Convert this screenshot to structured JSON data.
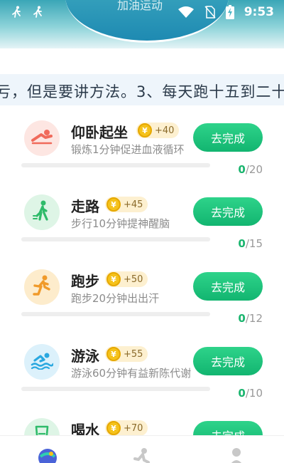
{
  "header": {
    "title": "加油运动"
  },
  "status_bar": {
    "time": "9:53"
  },
  "tip": {
    "text": "亏，但是要讲方法。3、每天跑十五到二十"
  },
  "tasks": [
    {
      "name": "仰卧起坐",
      "coin_symbol": "¥",
      "points": "+40",
      "desc": "锻炼1分钟促进血液循环",
      "button": "去完成",
      "done": "0",
      "total": "/20",
      "progress": 0,
      "icon": "situp-icon",
      "color": "#f06a5b",
      "bg": "#fde6e2"
    },
    {
      "name": "走路",
      "coin_symbol": "¥",
      "points": "+45",
      "desc": "步行10分钟提神醒脑",
      "button": "去完成",
      "done": "0",
      "total": "/15",
      "progress": 0,
      "icon": "walking-icon",
      "color": "#2fbb6a",
      "bg": "#def5e6"
    },
    {
      "name": "跑步",
      "coin_symbol": "¥",
      "points": "+50",
      "desc": "跑步20分钟出出汗",
      "button": "去完成",
      "done": "0",
      "total": "/12",
      "progress": 0,
      "icon": "running-icon",
      "color": "#f09a2a",
      "bg": "#fdeccc"
    },
    {
      "name": "游泳",
      "coin_symbol": "¥",
      "points": "+55",
      "desc": "游泳60分钟有益新陈代谢",
      "button": "去完成",
      "done": "0",
      "total": "/10",
      "progress": 0,
      "icon": "swimming-icon",
      "color": "#2aa8e0",
      "bg": "#dcf1fb"
    },
    {
      "name": "喝水",
      "coin_symbol": "¥",
      "points": "+70",
      "desc": "",
      "button": "去完成",
      "done": "",
      "total": "",
      "progress": 0,
      "icon": "water-cup-icon",
      "color": "#2fbb6a",
      "bg": "#def5e6"
    }
  ],
  "bottom_nav": [
    {
      "icon": "sport-home-icon",
      "active": true
    },
    {
      "icon": "running-man-icon",
      "active": false
    },
    {
      "icon": "profile-icon",
      "active": false
    }
  ],
  "colors": {
    "accent": "#1bc47d",
    "tip_bg": "#eef5fb",
    "badge_bg": "#fdf0d0"
  }
}
